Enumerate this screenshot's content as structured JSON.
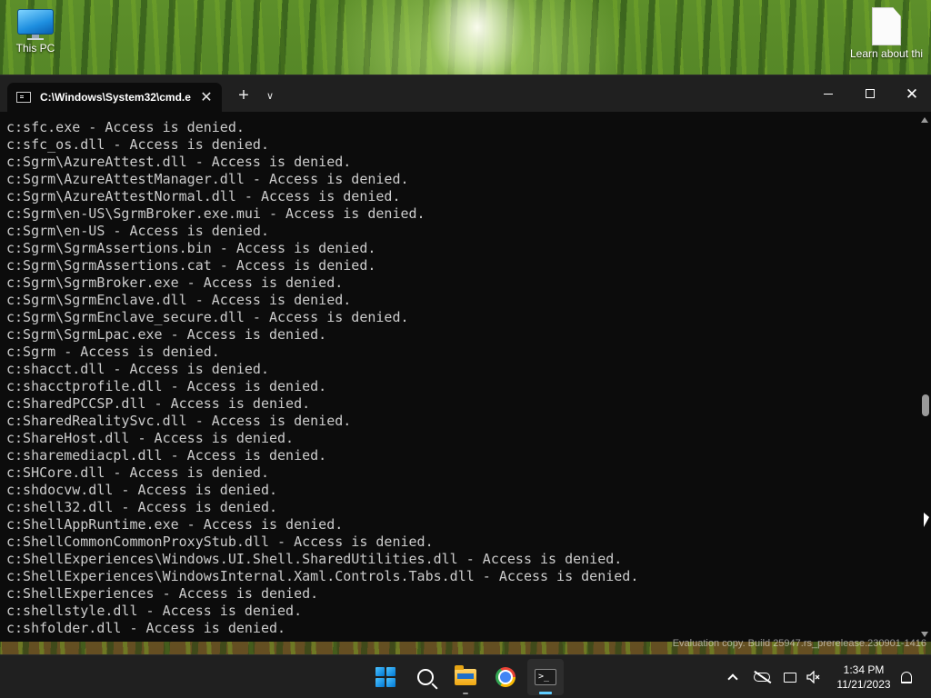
{
  "desktop": {
    "icons": [
      {
        "label": "This PC"
      },
      {
        "label": "Learn about this picture"
      }
    ],
    "watermark": "Evaluation copy. Build 25947.rs_prerelease.230901-1416"
  },
  "terminal": {
    "tab_title": "C:\\Windows\\System32\\cmd.e",
    "tab_close_glyph": "✕",
    "new_tab_glyph": "+",
    "dropdown_glyph": "∨",
    "close_glyph": "✕",
    "lines": [
      "c:sfc.exe - Access is denied.",
      "c:sfc_os.dll - Access is denied.",
      "c:Sgrm\\AzureAttest.dll - Access is denied.",
      "c:Sgrm\\AzureAttestManager.dll - Access is denied.",
      "c:Sgrm\\AzureAttestNormal.dll - Access is denied.",
      "c:Sgrm\\en-US\\SgrmBroker.exe.mui - Access is denied.",
      "c:Sgrm\\en-US - Access is denied.",
      "c:Sgrm\\SgrmAssertions.bin - Access is denied.",
      "c:Sgrm\\SgrmAssertions.cat - Access is denied.",
      "c:Sgrm\\SgrmBroker.exe - Access is denied.",
      "c:Sgrm\\SgrmEnclave.dll - Access is denied.",
      "c:Sgrm\\SgrmEnclave_secure.dll - Access is denied.",
      "c:Sgrm\\SgrmLpac.exe - Access is denied.",
      "c:Sgrm - Access is denied.",
      "c:shacct.dll - Access is denied.",
      "c:shacctprofile.dll - Access is denied.",
      "c:SharedPCCSP.dll - Access is denied.",
      "c:SharedRealitySvc.dll - Access is denied.",
      "c:ShareHost.dll - Access is denied.",
      "c:sharemediacpl.dll - Access is denied.",
      "c:SHCore.dll - Access is denied.",
      "c:shdocvw.dll - Access is denied.",
      "c:shell32.dll - Access is denied.",
      "c:ShellAppRuntime.exe - Access is denied.",
      "c:ShellCommonCommonProxyStub.dll - Access is denied.",
      "c:ShellExperiences\\Windows.UI.Shell.SharedUtilities.dll - Access is denied.",
      "c:ShellExperiences\\WindowsInternal.Xaml.Controls.Tabs.dll - Access is denied.",
      "c:ShellExperiences - Access is denied.",
      "c:shellstyle.dll - Access is denied.",
      "c:shfolder.dll - Access is denied."
    ]
  },
  "taskbar": {
    "terminal_prompt_glyph": ">_",
    "clock": {
      "time": "1:34 PM",
      "date": "11/21/2023"
    }
  }
}
